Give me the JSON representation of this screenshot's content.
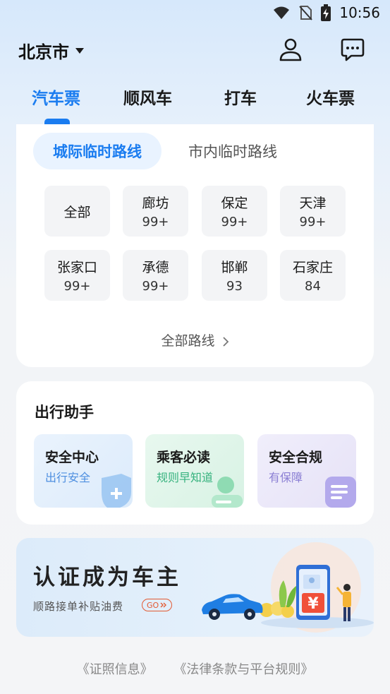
{
  "status_bar": {
    "time": "10:56"
  },
  "header": {
    "city": "北京市"
  },
  "tabs": [
    {
      "label": "汽车票"
    },
    {
      "label": "顺风车"
    },
    {
      "label": "打车"
    },
    {
      "label": "火车票"
    }
  ],
  "routes": {
    "sub_tabs": [
      {
        "label": "城际临时路线"
      },
      {
        "label": "市内临时路线"
      }
    ],
    "cities": [
      {
        "name": "全部",
        "count": ""
      },
      {
        "name": "廊坊",
        "count": "99+"
      },
      {
        "name": "保定",
        "count": "99+"
      },
      {
        "name": "天津",
        "count": "99+"
      },
      {
        "name": "张家口",
        "count": "99+"
      },
      {
        "name": "承德",
        "count": "99+"
      },
      {
        "name": "邯郸",
        "count": "93"
      },
      {
        "name": "石家庄",
        "count": "84"
      }
    ],
    "all_routes_label": "全部路线"
  },
  "assistant": {
    "title": "出行助手",
    "items": [
      {
        "title": "安全中心",
        "subtitle": "出行安全",
        "color": "#4e8fe0",
        "icon": "shield-icon"
      },
      {
        "title": "乘客必读",
        "subtitle": "规则早知道",
        "color": "#36b27e",
        "icon": "person-icon"
      },
      {
        "title": "安全合规",
        "subtitle": "有保障",
        "color": "#8b7fd4",
        "icon": "document-icon"
      }
    ]
  },
  "banner": {
    "title": "认证成为车主",
    "subtitle": "顺路接单补贴油费",
    "go_label": "GO",
    "yuan_symbol": "¥"
  },
  "footer": {
    "links": [
      "《证照信息》",
      "《法律条款与平台规则》"
    ]
  },
  "colors": {
    "accent": "#1a7cf0"
  }
}
